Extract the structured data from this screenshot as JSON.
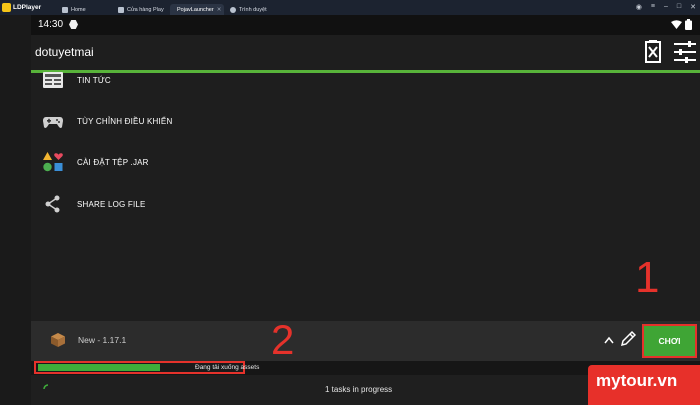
{
  "host": {
    "app_name": "LDPlayer",
    "tabs": [
      {
        "label": "Home"
      },
      {
        "label": "Cửa hàng Play"
      },
      {
        "label": "PojavLauncher"
      },
      {
        "label": "Trình duyệt"
      }
    ]
  },
  "statusbar": {
    "time": "14:30"
  },
  "appbar": {
    "title": "dotuyetmai",
    "icons": [
      "clear-log-icon",
      "settings-sliders-icon"
    ]
  },
  "menu": {
    "items": [
      {
        "label": "TIN TỨC",
        "icon": "news-icon"
      },
      {
        "label": "TÙY CHỈNH ĐIỀU KHIỂN",
        "icon": "gamepad-icon"
      },
      {
        "label": "CÀI ĐẶT TỆP .JAR",
        "icon": "shapes-icon"
      },
      {
        "label": "SHARE LOG FILE",
        "icon": "share-icon"
      }
    ]
  },
  "launcher": {
    "version": "New - 1.17.1",
    "play_label": "CHƠI",
    "progress_text": "Đang tải xuống assets",
    "progress_fraction": 0.59,
    "tasks_text": "1 tasks in progress"
  },
  "annotations": {
    "step1": "1",
    "step2": "2"
  },
  "watermark": {
    "text": "mytour.vn"
  },
  "colors": {
    "accent_green": "#3fa535",
    "annotation_red": "#e5322b",
    "background": "#1e1e1e"
  }
}
